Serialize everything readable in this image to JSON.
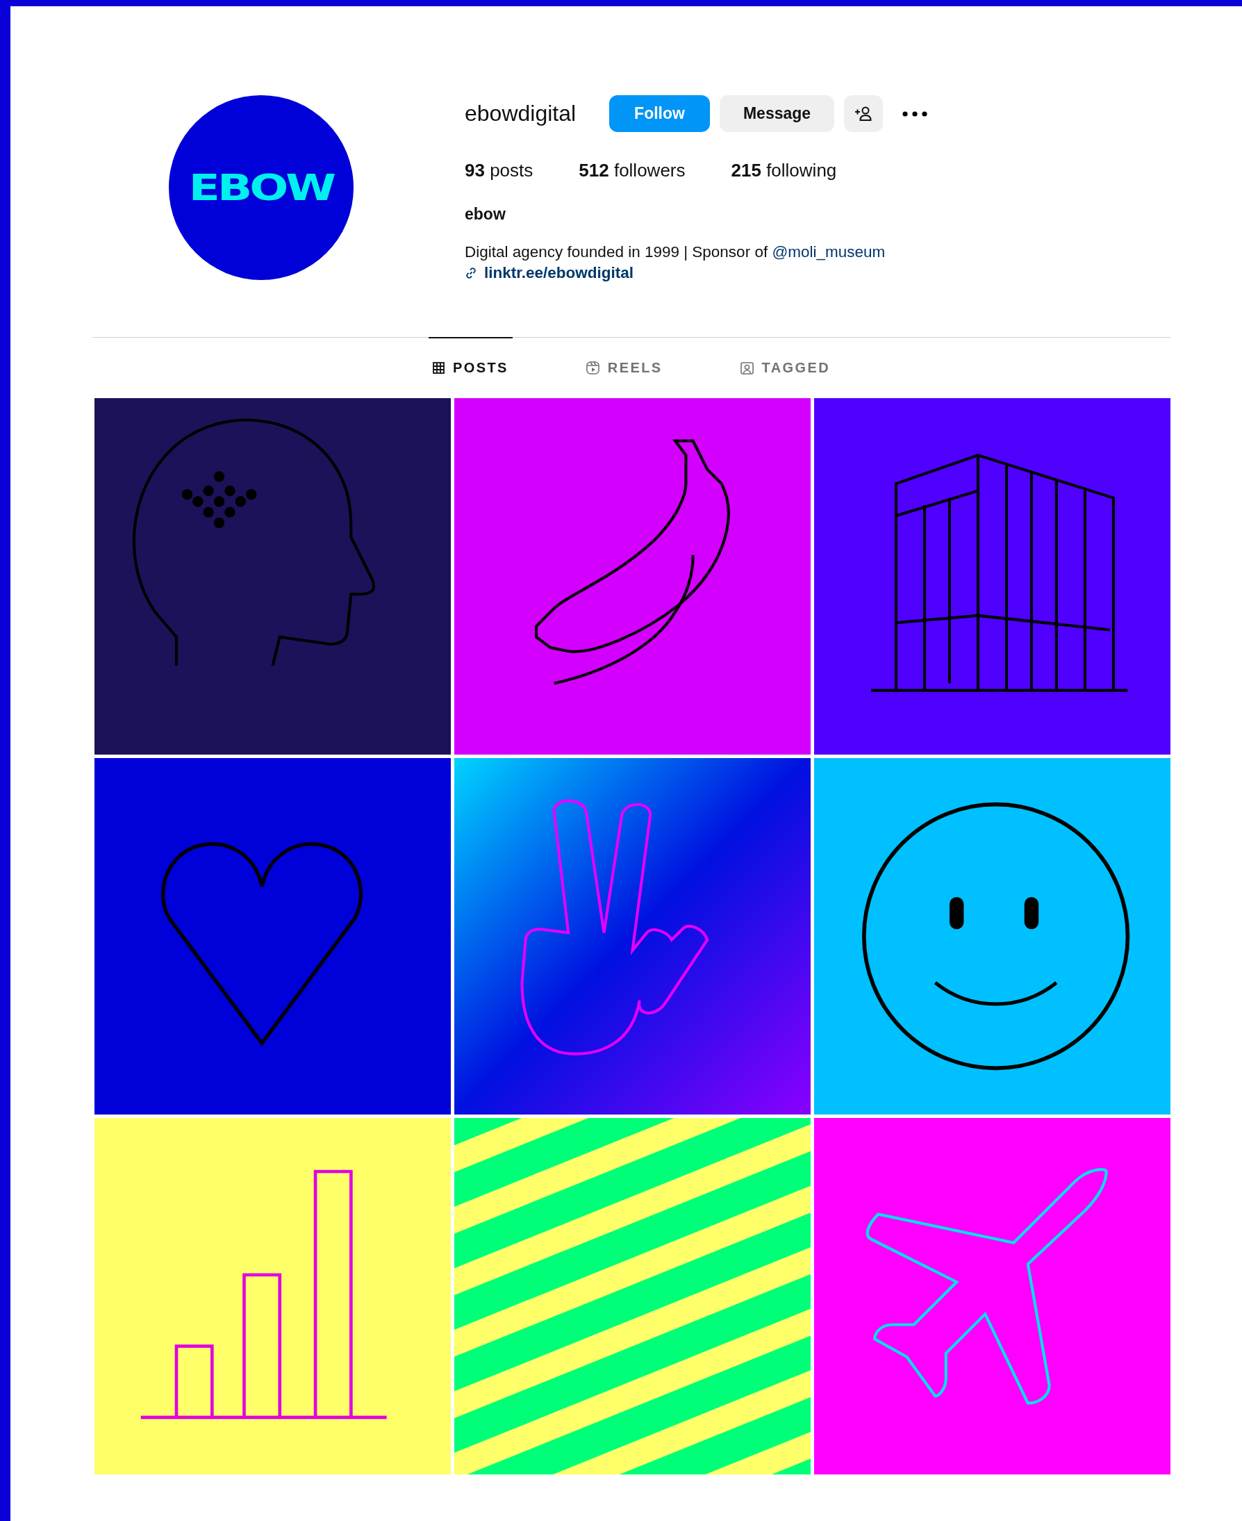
{
  "profile": {
    "avatar": {
      "logo_text": "EBOW"
    },
    "username": "ebowdigital",
    "buttons": [
      {
        "kind": "primary",
        "label": "Follow"
      },
      {
        "kind": "secondary",
        "label": "Message"
      },
      {
        "kind": "add-person"
      },
      {
        "kind": "more"
      }
    ],
    "stats": [
      "**93** posts",
      "**512** followers",
      "**215** following"
    ],
    "name": "ebow",
    "bio": {
      "text": "Digital agency founded in 1999 | Sponsor of ",
      "mention": "@moli_museum"
    },
    "link": "linktr.ee/ebowdigital"
  },
  "tabs": [
    {
      "label": "POSTS",
      "selected": true
    },
    {
      "label": "REELS",
      "selected": false
    },
    {
      "label": "TAGGED",
      "selected": false
    }
  ]
}
